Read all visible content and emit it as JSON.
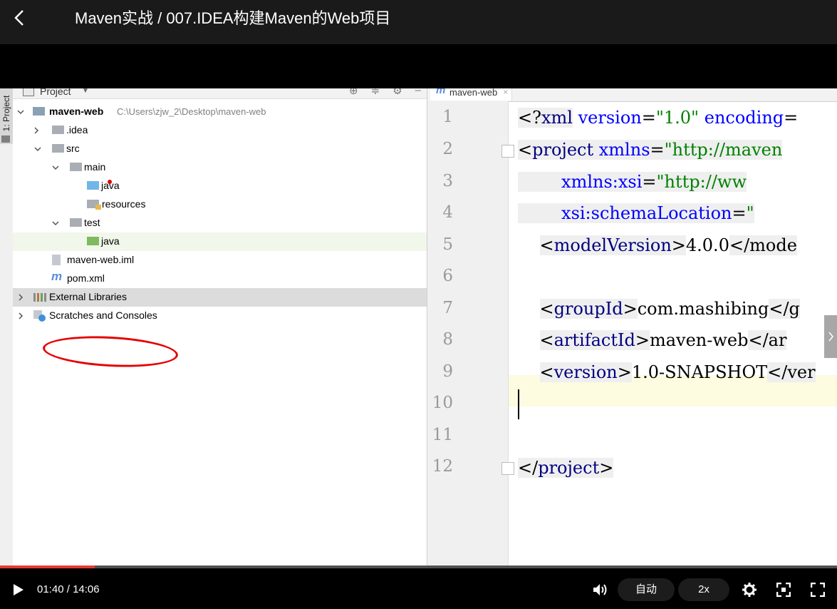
{
  "header": {
    "title": "Maven实战 / 007.IDEA构建Maven的Web项目",
    "back_icon": "chevron-left-icon"
  },
  "ide": {
    "left_tool_tab": "1: Project",
    "project_panel": {
      "title": "Project",
      "tree": [
        {
          "label": "maven-web",
          "path": "C:\\Users\\zjw_2\\Desktop\\maven-web",
          "expanded": true
        },
        {
          "label": ".idea",
          "expanded": false
        },
        {
          "label": "src",
          "expanded": true
        },
        {
          "label": "main",
          "expanded": true
        },
        {
          "label": "java"
        },
        {
          "label": "resources"
        },
        {
          "label": "test",
          "expanded": true
        },
        {
          "label": "java"
        },
        {
          "label": "maven-web.iml"
        },
        {
          "label": "pom.xml"
        },
        {
          "label": "External Libraries",
          "expanded": false
        },
        {
          "label": "Scratches and Consoles",
          "expanded": false
        }
      ]
    },
    "editor": {
      "tab_label": "maven-web",
      "line_numbers": [
        "1",
        "2",
        "3",
        "4",
        "5",
        "6",
        "7",
        "8",
        "9",
        "10",
        "11",
        "12"
      ],
      "code": {
        "l1": {
          "open": "<?",
          "name": "xml",
          "a1": "version",
          "v1": "\"1.0\"",
          "a2": "encoding"
        },
        "l2": {
          "open": "<",
          "name": "project",
          "a1": "xmlns",
          "v1": "\"http://maven"
        },
        "l3": {
          "a1": "xmlns:xsi",
          "v1": "\"http://ww"
        },
        "l4": {
          "a1": "xsi:schemaLocation",
          "v1": "\""
        },
        "l5": {
          "name": "modelVersion",
          "text": "4.0.0",
          "close": "</mode"
        },
        "l7": {
          "name": "groupId",
          "text": "com.mashibing",
          "close": "</g"
        },
        "l8": {
          "name": "artifactId",
          "text": "maven-web",
          "close": "</ar"
        },
        "l9": {
          "name": "version",
          "text": "1.0-SNAPSHOT",
          "close": "</ver"
        },
        "l12": {
          "close_name": "project"
        }
      }
    }
  },
  "player": {
    "time_current": "01:40",
    "time_total": "14:06",
    "progress_fraction": 0.1135,
    "quality_label": "自动",
    "speed_label": "2x",
    "accent_color": "#e53935"
  }
}
